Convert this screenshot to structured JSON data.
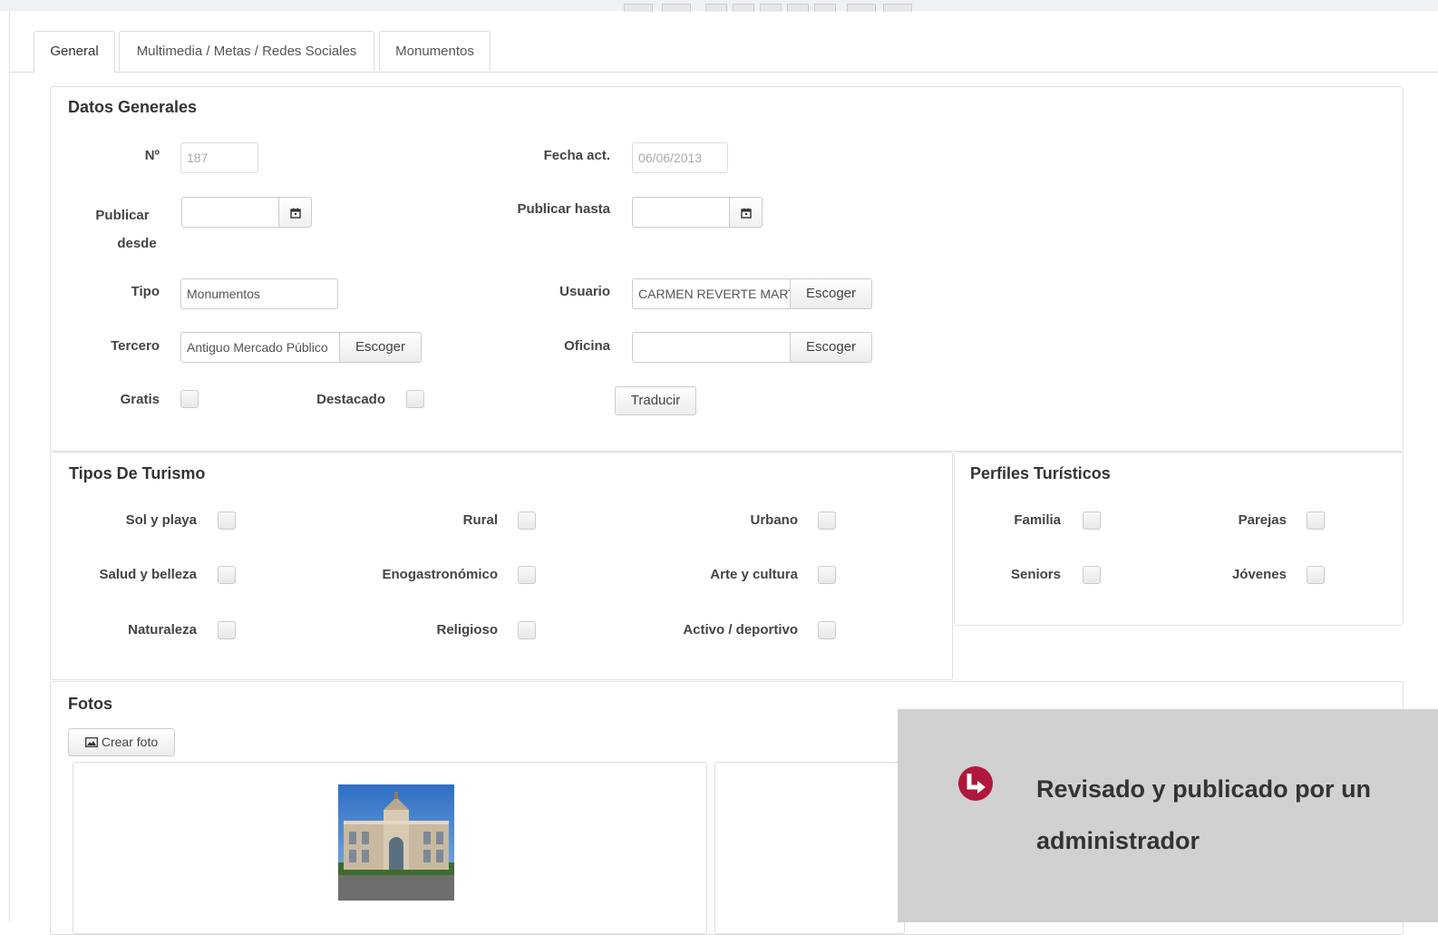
{
  "tabs": [
    {
      "label": "General",
      "active": true
    },
    {
      "label": "Multimedia / Metas / Redes Sociales",
      "active": false
    },
    {
      "label": "Monumentos",
      "active": false
    }
  ],
  "datos_generales": {
    "title": "Datos Generales",
    "numero_label": "Nº",
    "numero_value": "187",
    "fecha_act_label": "Fecha act.",
    "fecha_act_value": "06/06/2013",
    "publicar_desde_label_1": "Publicar",
    "publicar_desde_label_2": "desde",
    "publicar_desde_value": "",
    "publicar_hasta_label": "Publicar hasta",
    "publicar_hasta_value": "",
    "tipo_label": "Tipo",
    "tipo_value": "Monumentos",
    "usuario_label": "Usuario",
    "usuario_value": "CARMEN REVERTE MARTINEZ",
    "tercero_label": "Tercero",
    "tercero_value": "Antiguo Mercado Público",
    "oficina_label": "Oficina",
    "oficina_value": "",
    "escoger_label": "Escoger",
    "gratis_label": "Gratis",
    "destacado_label": "Destacado",
    "traducir_label": "Traducir"
  },
  "tipos_turismo": {
    "title": "Tipos De Turismo",
    "items": [
      "Sol y playa",
      "Rural",
      "Urbano",
      "Salud y belleza",
      "Enogastronómico",
      "Arte y cultura",
      "Naturaleza",
      "Religioso",
      "Activo / deportivo"
    ]
  },
  "perfiles": {
    "title": "Perfiles Turísticos",
    "items": [
      "Familia",
      "Parejas",
      "Seniors",
      "Jóvenes"
    ]
  },
  "fotos": {
    "title": "Fotos",
    "crear_label": "Crear foto"
  },
  "overlay": {
    "text": "Revisado y publicado por un administrador",
    "accent": "#b0173b"
  },
  "icons": {
    "calendar": "calendar-icon",
    "image": "image-icon",
    "arrow": "turn-arrow-icon"
  }
}
